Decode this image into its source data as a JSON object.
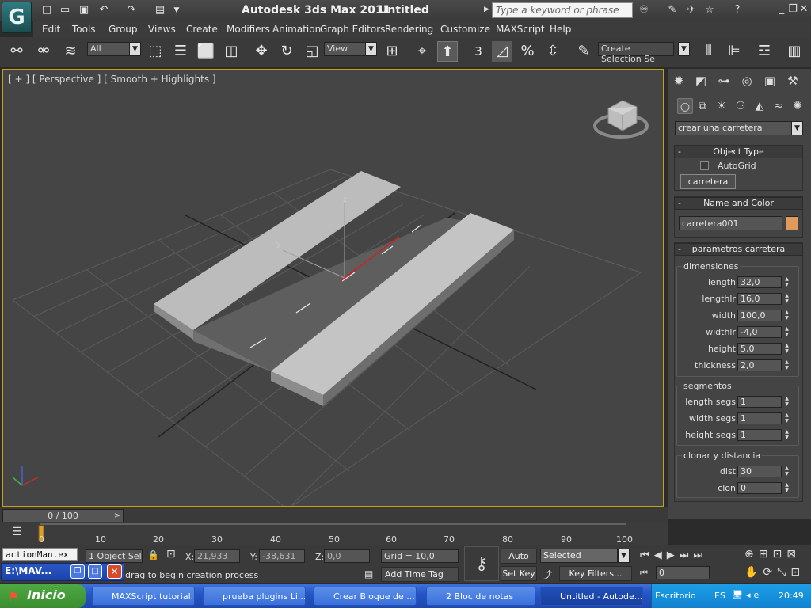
{
  "titlebar": {
    "app_title": "Autodesk 3ds Max  2011",
    "doc_title": "Untitled",
    "search_placeholder": "Type a keyword or phrase"
  },
  "menu": [
    "Edit",
    "Tools",
    "Group",
    "Views",
    "Create",
    "Modifiers",
    "Animation",
    "Graph Editors",
    "Rendering",
    "Customize",
    "MAXScript",
    "Help"
  ],
  "toolbar": {
    "selection_filter": "All",
    "reference_coord": "View",
    "snap_label": "3",
    "named_selection": "Create Selection Se"
  },
  "viewport": {
    "label": "[ + ] [ Perspective ] [ Smooth + Highlights ]"
  },
  "command_panel": {
    "category": "crear una carretera",
    "object_type": {
      "title": "Object Type",
      "autogrid_label": "AutoGrid",
      "object_button": "carretera"
    },
    "name_color": {
      "title": "Name and Color",
      "name": "carretera001",
      "color": "#e09a5e"
    },
    "params": {
      "title": "parametros carretera",
      "groups": [
        {
          "label": "dimensiones",
          "fields": [
            {
              "label": "length",
              "value": "32,0"
            },
            {
              "label": "lengthlr",
              "value": "16,0"
            },
            {
              "label": "width",
              "value": "100,0"
            },
            {
              "label": "widthlr",
              "value": "-4,0"
            },
            {
              "label": "height",
              "value": "5,0"
            },
            {
              "label": "thickness",
              "value": "2,0"
            }
          ]
        },
        {
          "label": "segmentos",
          "fields": [
            {
              "label": "length segs",
              "value": "1"
            },
            {
              "label": "width segs",
              "value": "1"
            },
            {
              "label": "height segs",
              "value": "1"
            }
          ]
        },
        {
          "label": "clonar y distancia",
          "fields": [
            {
              "label": "dist",
              "value": "30"
            },
            {
              "label": "clon",
              "value": "0"
            }
          ]
        }
      ]
    }
  },
  "timeline": {
    "frame_display": "0 / 100",
    "ticks": [
      "0",
      "10",
      "20",
      "30",
      "40",
      "50",
      "60",
      "70",
      "80",
      "90",
      "100"
    ]
  },
  "status": {
    "maxscript_listener": "actionMan.ex",
    "selection_count": "1 Object Sele",
    "prompt": "drag to begin creation process",
    "x_label": "X:",
    "x_value": "21,933",
    "y_label": "Y:",
    "y_value": "-38,631",
    "z_label": "Z:",
    "z_value": "0,0",
    "grid": "Grid = 10,0",
    "add_time_tag": "Add Time Tag",
    "auto_key": "Auto Key",
    "set_key": "Set Key",
    "key_mode": "Selected",
    "key_filters": "Key Filters...",
    "current_frame": "0",
    "floating_window": "E:\\MAV..."
  },
  "taskbar": {
    "start": "Inicio",
    "tasks": [
      "MAXScript tutorial...",
      "prueba plugins Li...",
      "Crear Bloque de ...",
      "2 Bloc de notas",
      "Untitled - Autode..."
    ],
    "desktop": "Escritorio",
    "lang": "ES",
    "clock": "20:49"
  }
}
